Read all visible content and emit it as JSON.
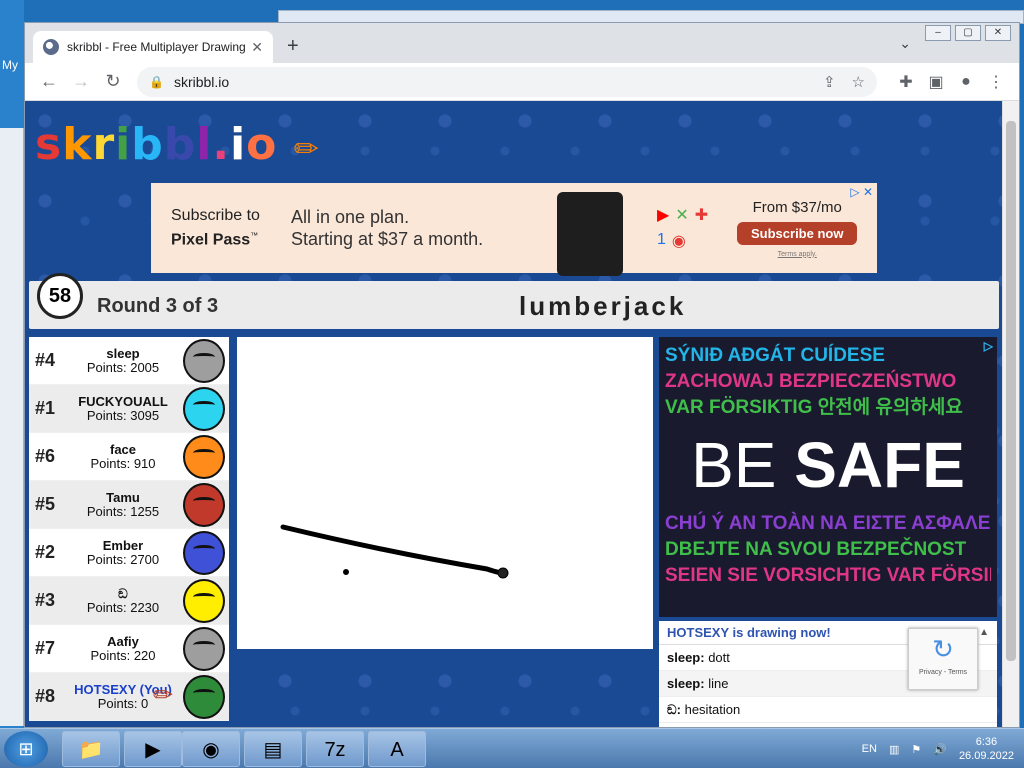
{
  "desktop": {
    "icon_label": "My"
  },
  "window_controls": [
    "–",
    "▢",
    "✕"
  ],
  "tab": {
    "title": "skribbl - Free Multiplayer Drawing",
    "close": "✕",
    "new_tab": "+"
  },
  "omnibox": {
    "url": "skribbl.io"
  },
  "logo": {
    "text": [
      "s",
      "k",
      "r",
      "i",
      "b",
      "b",
      "l",
      ".",
      "i",
      "o"
    ]
  },
  "ad_top": {
    "line1": "Subscribe to",
    "line2": "Pixel Pass",
    "plan1": "All in one plan.",
    "plan2": "Starting at $37 a month.",
    "price": "From $37/mo",
    "button": "Subscribe now",
    "terms": "Terms apply."
  },
  "game": {
    "timer": "58",
    "round": "Round 3 of 3",
    "word": "lumberjack"
  },
  "players": [
    {
      "rank": "#4",
      "name": "sleep",
      "points": "Points: 2005",
      "color": "#9e9e9e"
    },
    {
      "rank": "#1",
      "name": "FUCKYOUALL",
      "points": "Points: 3095",
      "color": "#2dd4f0"
    },
    {
      "rank": "#6",
      "name": "face",
      "points": "Points: 910",
      "color": "#ff8c1a"
    },
    {
      "rank": "#5",
      "name": "Tamu",
      "points": "Points: 1255",
      "color": "#c0392b"
    },
    {
      "rank": "#2",
      "name": "Ember",
      "points": "Points: 2700",
      "color": "#3f51d6"
    },
    {
      "rank": "#3",
      "name": "ඞ",
      "points": "Points: 2230",
      "color": "#ffee00"
    },
    {
      "rank": "#7",
      "name": "Aafiy",
      "points": "Points: 220",
      "color": "#9e9e9e"
    },
    {
      "rank": "#8",
      "name": "HOTSEXY (You)",
      "points": "Points: 0",
      "color": "#2e8b3a"
    }
  ],
  "safe_ad": {
    "lines_top": [
      {
        "text": "SÝNIÐ AÐGÁT CUÍDESE",
        "color": "#22b5e8"
      },
      {
        "text": "ZACHOWAJ BEZPIECZEŃSTWO",
        "color": "#e0368a"
      },
      {
        "text": "VAR FÖRSIKTIG 안전에 유의하세요",
        "color": "#3fbf4a"
      }
    ],
    "be": "BE",
    "safe": "SAFE",
    "lines_bottom": [
      {
        "text": "CHÚ Ý AN TOÀN  ΝΑ ΕΙΣΤΕ ΑΣΦΑΛΕΙΣ",
        "color": "#8a3fd1"
      },
      {
        "text": "DBEJTE NA SVOU BEZPEČNOST",
        "color": "#3fbf4a"
      },
      {
        "text": "SEIEN SIE VORSICHTIG VAR FÖRSIKTIG",
        "color": "#e0368a"
      }
    ]
  },
  "chat": {
    "header": "HOTSEXY is drawing now!",
    "messages": [
      {
        "user": "sleep:",
        "text": "dott"
      },
      {
        "user": "sleep:",
        "text": "line"
      },
      {
        "user": "ඞ:",
        "text": "hesitation"
      }
    ]
  },
  "recaptcha": {
    "label": "Privacy - Terms"
  },
  "taskbar": {
    "lang": "EN",
    "time": "6:36",
    "date": "26.09.2022"
  }
}
